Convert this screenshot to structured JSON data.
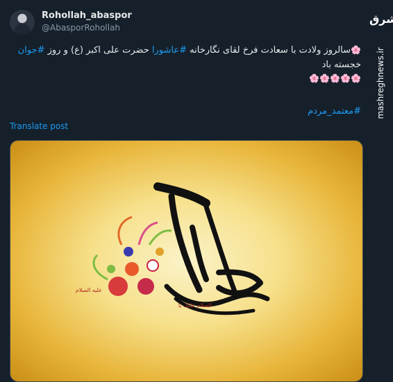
{
  "author": {
    "display_name": "Rohollah_abaspor",
    "handle": "@AbasporRohollah"
  },
  "post": {
    "line1": {
      "flower": "🌸",
      "text_a": "سالروز ولادت با سعادت فرخ لقای نگارخانه ",
      "hashtag_a": "#عاشورا",
      "text_b": " حضرت علی اکبر (ع) و روز ",
      "hashtag_b": "#جوان"
    },
    "line2": "خجسته باد",
    "flowers": [
      "🌸",
      "🌸",
      "🌸",
      "🌸",
      "🌸"
    ],
    "hashtag_line": "#معتمد_مردم",
    "translate_label": "Translate post"
  },
  "image": {
    "calligraphy_caption_left": "علیه السلام",
    "calligraphy_caption_bottom": "السلام علیک یا"
  },
  "watermark": {
    "logo": "مشرق",
    "site": "mashreghnews.ir"
  },
  "colors": {
    "background": "#15202b",
    "text": "#e7e9ea",
    "secondary_text": "#8b98a5",
    "link": "#1d9bf0"
  }
}
